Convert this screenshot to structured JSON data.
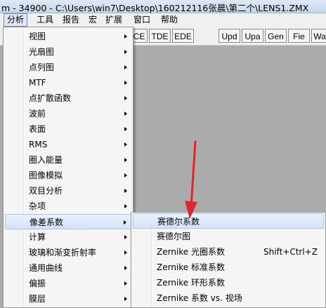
{
  "window": {
    "title": "m - 34900 - C:\\Users\\win7\\Desktop\\160212116张晨\\第二个\\LENS1.ZMX"
  },
  "menubar": {
    "items": [
      {
        "label": "分析",
        "active": true
      },
      {
        "label": "工具"
      },
      {
        "label": "报告"
      },
      {
        "label": "宏"
      },
      {
        "label": "扩展"
      },
      {
        "label": "窗口"
      },
      {
        "label": "帮助"
      }
    ]
  },
  "toolbar": {
    "buttons": [
      "CE",
      "TDE",
      "EDE",
      "Upd",
      "Upa",
      "Gen",
      "Fie",
      "Wa"
    ]
  },
  "analysis_menu": {
    "items": [
      {
        "label": "视图",
        "submenu": true
      },
      {
        "label": "光扇图",
        "submenu": true
      },
      {
        "label": "点列图",
        "submenu": true
      },
      {
        "label": "MTF",
        "submenu": true
      },
      {
        "label": "点扩散函数",
        "submenu": true
      },
      {
        "label": "波前",
        "submenu": true
      },
      {
        "label": "表面",
        "submenu": true
      },
      {
        "label": "RMS",
        "submenu": true
      },
      {
        "label": "圈入能量",
        "submenu": true
      },
      {
        "label": "图像模拟",
        "submenu": true
      },
      {
        "label": "双目分析",
        "submenu": true
      },
      {
        "label": "杂项",
        "submenu": true
      },
      {
        "label": "像差系数",
        "submenu": true,
        "highlighted": true
      },
      {
        "label": "计算",
        "submenu": true
      },
      {
        "label": "玻璃和渐变折射率",
        "submenu": true
      },
      {
        "label": "通用曲线",
        "submenu": true
      },
      {
        "label": "偏振",
        "submenu": true
      },
      {
        "label": "膜层",
        "submenu": true
      }
    ]
  },
  "aberration_submenu": {
    "items": [
      {
        "label": "赛德尔系数",
        "shortcut": "",
        "highlighted": true
      },
      {
        "label": "赛德尔图",
        "shortcut": ""
      },
      {
        "label": "Zernike 光圈系数",
        "shortcut": "Shift+Ctrl+Z"
      },
      {
        "label": "Zernike 标准系数",
        "shortcut": ""
      },
      {
        "label": "Zernike 环形系数",
        "shortcut": ""
      },
      {
        "label": "Zernike 系数 vs. 视场",
        "shortcut": ""
      }
    ]
  },
  "colors": {
    "workspace": "#ababab",
    "annotation_arrow": "#e0262b",
    "highlight": "#d3e4f8"
  }
}
